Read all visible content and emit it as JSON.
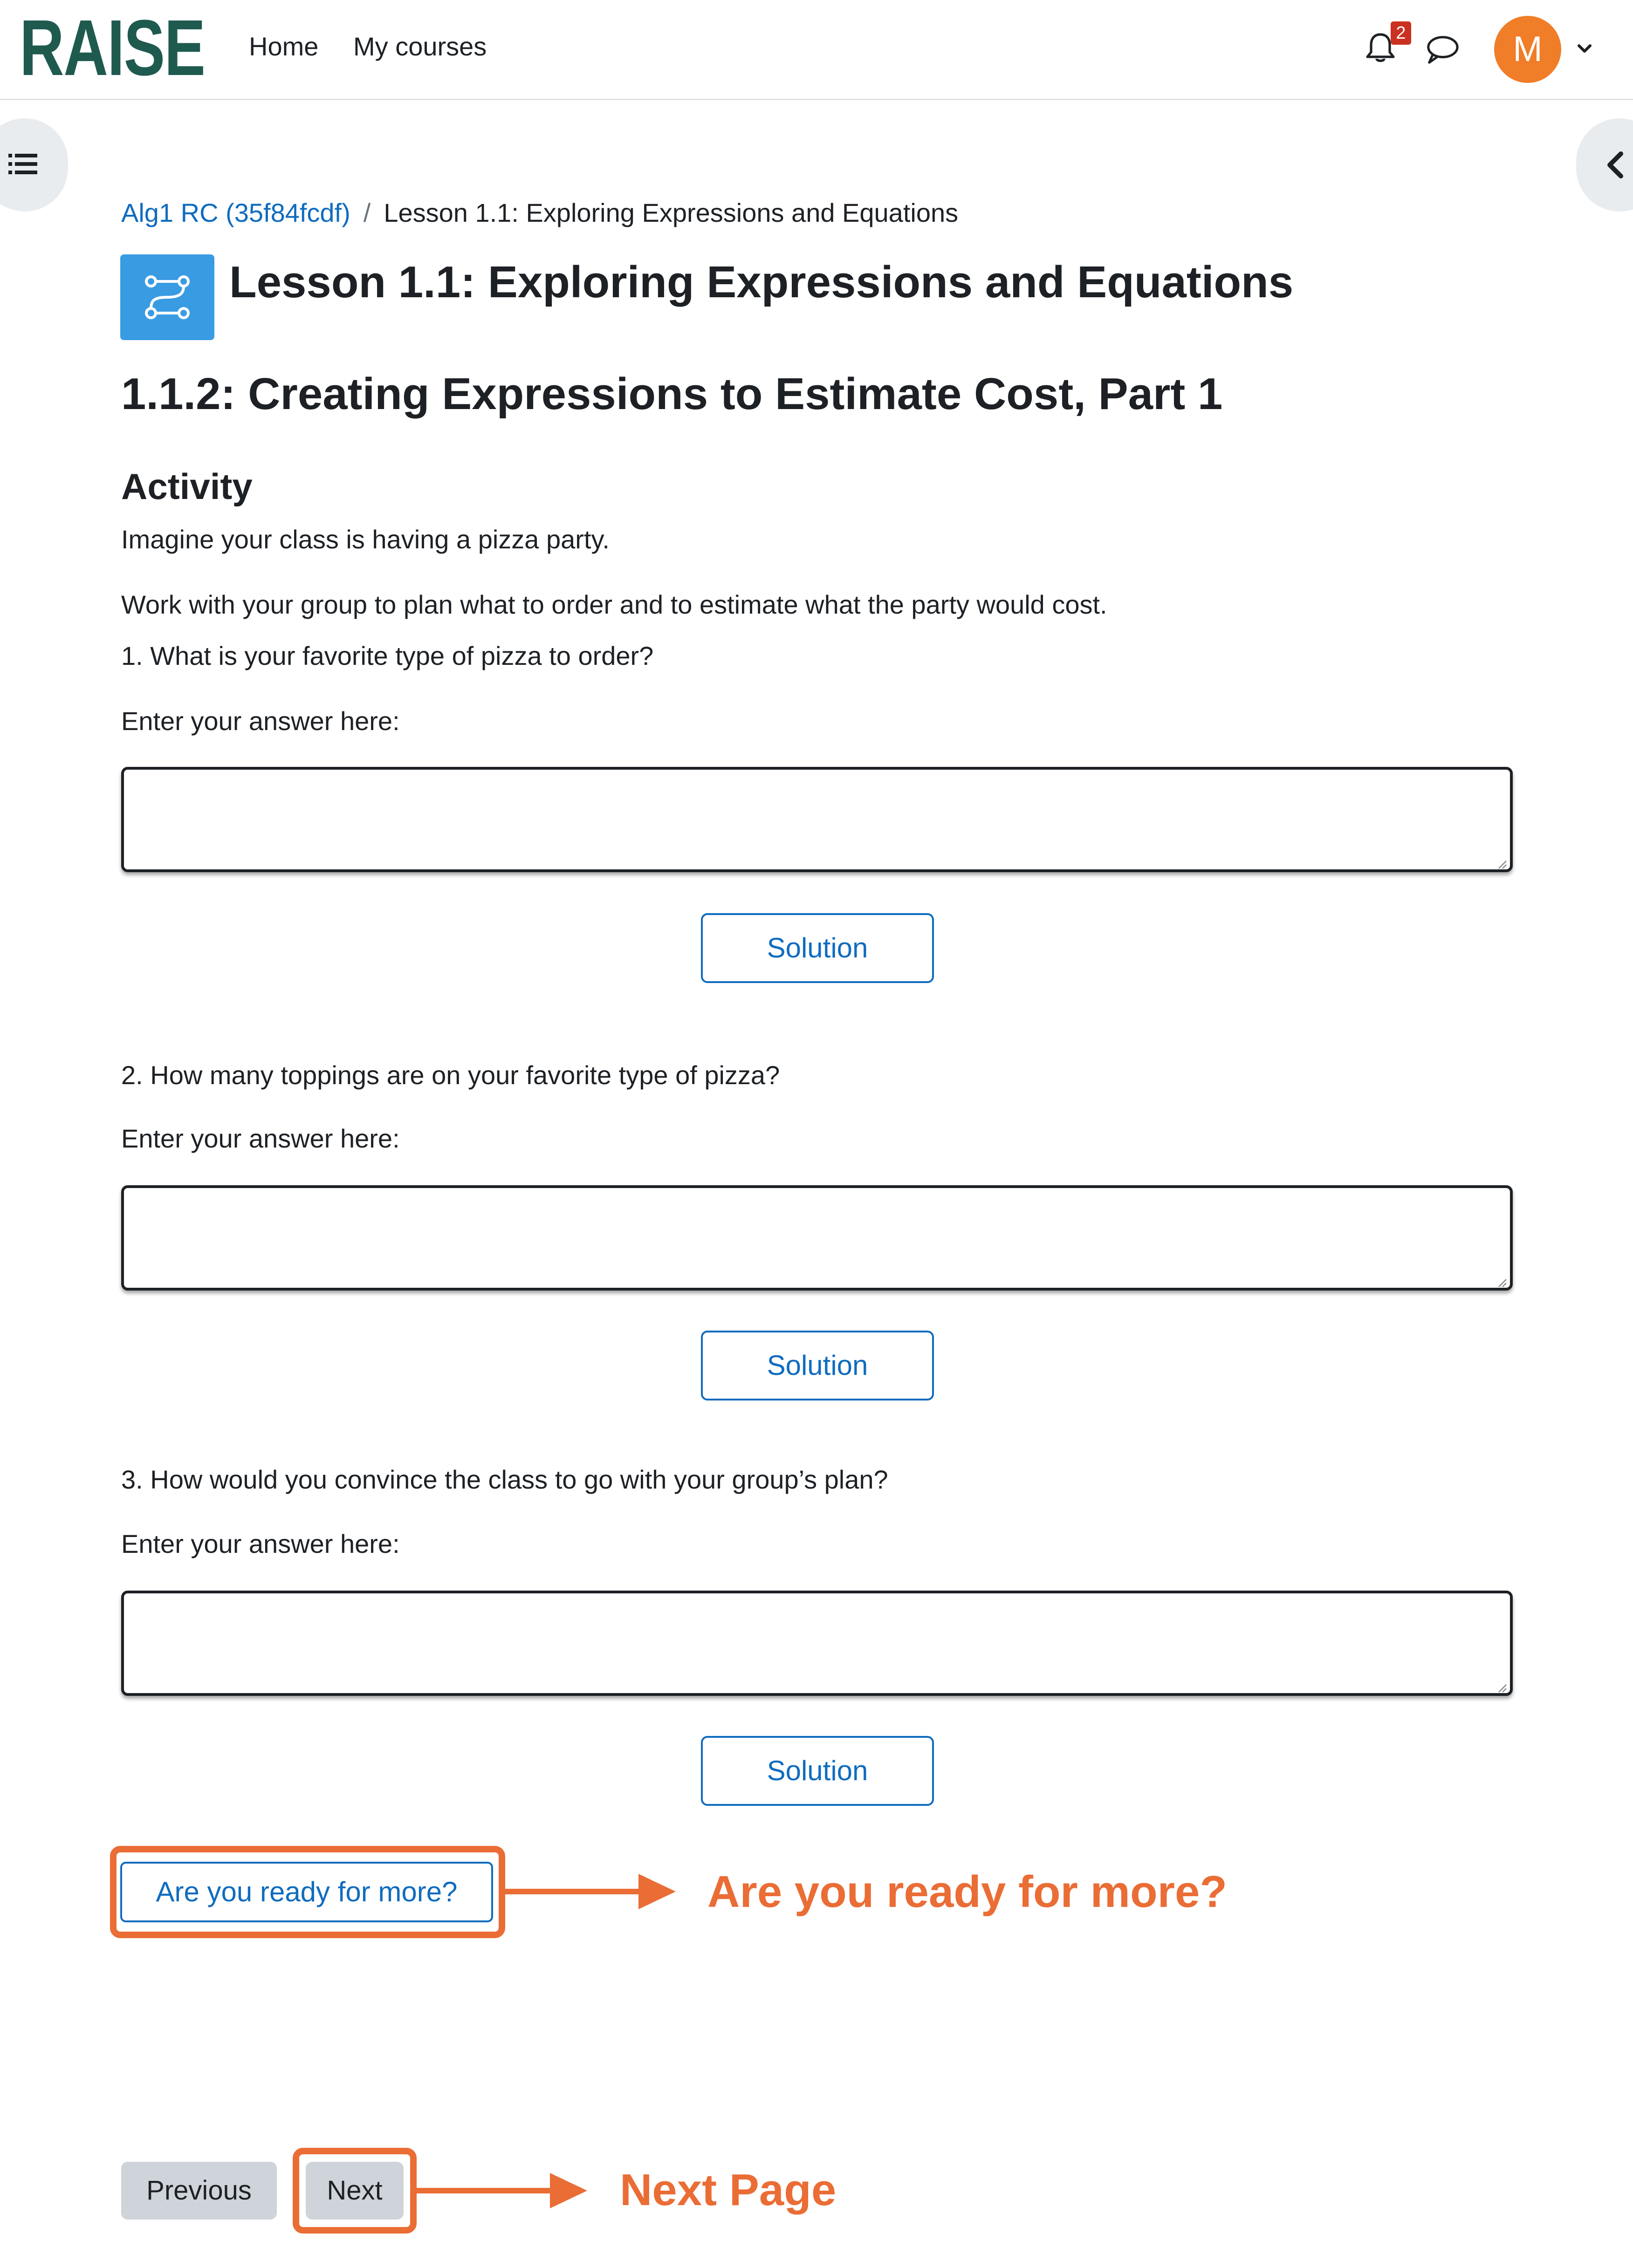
{
  "header": {
    "logo": "RAISE",
    "nav": [
      {
        "label": "Home"
      },
      {
        "label": "My courses"
      }
    ],
    "notification_count": "2",
    "user_initial": "M"
  },
  "breadcrumb": {
    "course": "Alg1 RC (35f84fcdf)",
    "separator": "/",
    "current": "Lesson 1.1: Exploring Expressions and Equations"
  },
  "page": {
    "title": "Lesson 1.1: Exploring Expressions and Equations",
    "subtitle": "1.1.2: Creating Expressions to Estimate Cost, Part 1",
    "section": "Activity",
    "intro": "Imagine your class is having a pizza party.",
    "instructions": "Work with your group to plan what to order and to estimate what the party would cost."
  },
  "questions": [
    {
      "prompt": "1. What is your favorite type of pizza to order?",
      "answer_label": "Enter your answer here:",
      "answer_value": "",
      "solution_label": "Solution"
    },
    {
      "prompt": "2. How many toppings are on your favorite type of pizza?",
      "answer_label": "Enter your answer here:",
      "answer_value": "",
      "solution_label": "Solution"
    },
    {
      "prompt": "3. How would you convince the class to go with your group’s plan?",
      "answer_label": "Enter your answer here:",
      "answer_value": "",
      "solution_label": "Solution"
    }
  ],
  "more": {
    "button_label": "Are you ready for more?",
    "annotation": "Are you ready for more?"
  },
  "pagination": {
    "previous_label": "Previous",
    "next_label": "Next",
    "annotation": "Next Page"
  },
  "colors": {
    "accent": "#0f6cbf",
    "annotation": "#ea6d35",
    "logo": "#1f5a4f",
    "avatar": "#f07d27",
    "lesson_icon": "#399be2",
    "badge": "#ca3120"
  },
  "icons": {
    "notification": "bell-icon",
    "messages": "chat-bubble-icon",
    "user_menu": "chevron-down-icon",
    "course_index": "list-icon",
    "block_drawer": "chevron-left-icon",
    "lesson": "lesson-icon"
  }
}
